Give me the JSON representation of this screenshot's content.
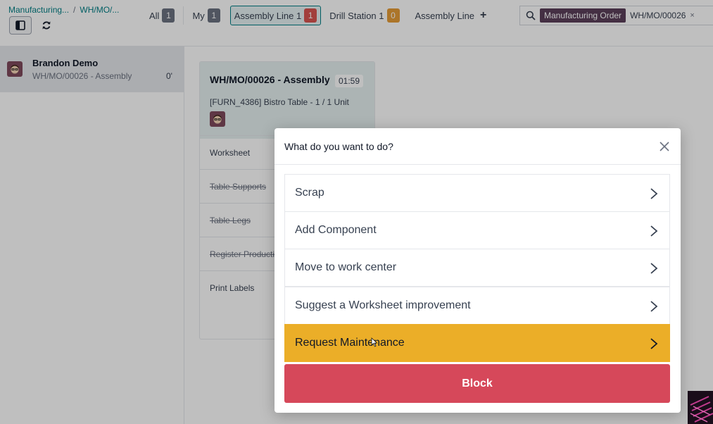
{
  "breadcrumb": {
    "item1": "Manufacturing...",
    "separator": "/",
    "item2": "WH/MO/..."
  },
  "toolbar": {
    "toggle_icon": "panel-toggle-icon",
    "refresh_icon": "refresh-icon"
  },
  "filters": [
    {
      "label": "All",
      "count": "1"
    },
    {
      "label": "My",
      "count": "1"
    },
    {
      "label": "Assembly Line 1",
      "count": "1",
      "color": "#d9534f"
    },
    {
      "label": "Drill Station 1",
      "count": "0",
      "color": "#e69c37"
    },
    {
      "label": "Assembly Line",
      "add_icon": "+"
    }
  ],
  "search": {
    "facet_label": "Manufacturing Order",
    "facet_value": "WH/MO/00026",
    "remove": "×"
  },
  "employee": {
    "name": "Brandon Demo",
    "order": "WH/MO/00026 - Assembly",
    "time": "0'"
  },
  "card": {
    "title": "WH/MO/00026 - Assembly",
    "timer": "01:59",
    "product": "[FURN_4386] Bistro Table - 1 / 1 Unit",
    "steps": [
      {
        "label": "Worksheet",
        "done": false
      },
      {
        "label": "Table Supports",
        "done": true
      },
      {
        "label": "Table Legs",
        "done": true
      },
      {
        "label": "Register Production",
        "done": true
      },
      {
        "label": "Print Labels",
        "done": false
      }
    ]
  },
  "dialog": {
    "title": "What do you want to do?",
    "close": "close-icon",
    "actions": [
      {
        "label": "Scrap"
      },
      {
        "label": "Add Component"
      },
      {
        "label": "Move to work center"
      },
      {
        "label": "Suggest a Worksheet improvement"
      },
      {
        "label": "Request Maintenance",
        "highlight": true
      }
    ],
    "block_label": "Block"
  },
  "colors": {
    "accent": "#017e84",
    "warning": "#ebae28",
    "danger": "#d6485a",
    "facet": "#5b3f5a"
  }
}
